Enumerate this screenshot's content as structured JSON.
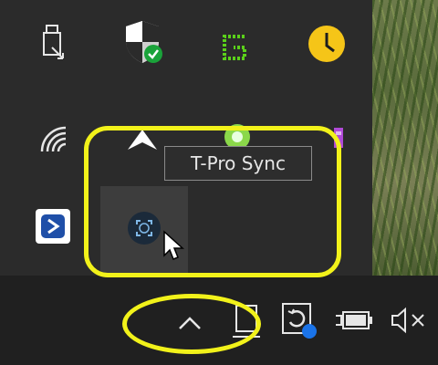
{
  "tooltip": {
    "text": "T-Pro Sync"
  },
  "overflow_icons": [
    {
      "name": "usb-eject-icon"
    },
    {
      "name": "defender-shield-icon"
    },
    {
      "name": "green-g-icon"
    },
    {
      "name": "clock-app-icon"
    },
    {
      "name": "wifi-icon"
    },
    {
      "name": "white-app-icon"
    },
    {
      "name": "green-app-icon"
    },
    {
      "name": "purple-app-icon"
    },
    {
      "name": "blue-square-app-icon"
    },
    {
      "name": "t-pro-sync-icon"
    }
  ],
  "taskbar_icons": [
    {
      "name": "show-hidden-icons-chevron-icon"
    },
    {
      "name": "network-icon"
    },
    {
      "name": "sync-notification-icon"
    },
    {
      "name": "battery-icon"
    },
    {
      "name": "volume-muted-icon"
    }
  ],
  "colors": {
    "annotation": "#f2f21a",
    "panel": "#2b2b2b",
    "taskbar": "#202020",
    "defender_green": "#1aa33a",
    "clock_yellow": "#f5c518",
    "sync_blue": "#1a73e8"
  }
}
